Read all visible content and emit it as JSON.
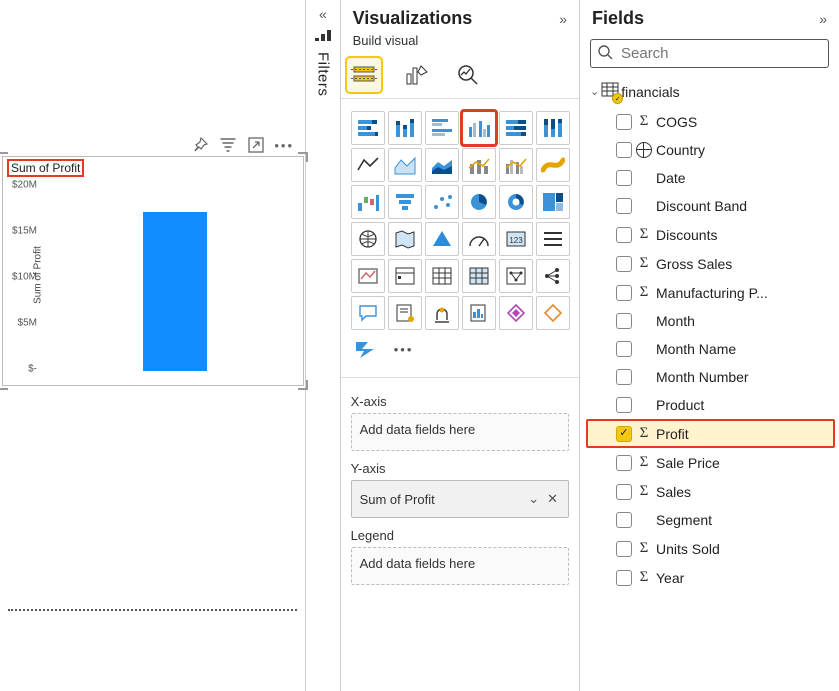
{
  "filters": {
    "label": "Filters"
  },
  "visualizations": {
    "title": "Visualizations",
    "subtitle": "Build visual",
    "wells": {
      "xaxis": {
        "label": "X-axis",
        "placeholder": "Add data fields here"
      },
      "yaxis": {
        "label": "Y-axis",
        "value": "Sum of Profit"
      },
      "legend": {
        "label": "Legend",
        "placeholder": "Add data fields here"
      }
    }
  },
  "fields": {
    "title": "Fields",
    "search_placeholder": "Search",
    "table": "financials",
    "items": [
      {
        "name": "COGS",
        "sigma": true,
        "checked": false
      },
      {
        "name": "Country",
        "globe": true,
        "checked": false
      },
      {
        "name": "Date",
        "checked": false
      },
      {
        "name": "Discount Band",
        "checked": false
      },
      {
        "name": "Discounts",
        "sigma": true,
        "checked": false
      },
      {
        "name": "Gross Sales",
        "sigma": true,
        "checked": false
      },
      {
        "name": "Manufacturing P...",
        "sigma": true,
        "checked": false
      },
      {
        "name": "Month",
        "checked": false
      },
      {
        "name": "Month Name",
        "checked": false
      },
      {
        "name": "Month Number",
        "checked": false
      },
      {
        "name": "Product",
        "checked": false
      },
      {
        "name": "Profit",
        "sigma": true,
        "checked": true,
        "highlight": true
      },
      {
        "name": "Sale Price",
        "sigma": true,
        "checked": false
      },
      {
        "name": "Sales",
        "sigma": true,
        "checked": false
      },
      {
        "name": "Segment",
        "checked": false
      },
      {
        "name": "Units Sold",
        "sigma": true,
        "checked": false
      },
      {
        "name": "Year",
        "sigma": true,
        "checked": false
      }
    ]
  },
  "visual": {
    "title": "Sum of Profit",
    "ylabel": "Sum of Profit",
    "ticks": [
      "$20M",
      "$15M",
      "$10M",
      "$5M",
      "$-"
    ]
  },
  "chart_data": {
    "type": "bar",
    "title": "Sum of Profit",
    "ylabel": "Sum of Profit",
    "ylim": [
      0,
      20000000
    ],
    "yticks": [
      0,
      5000000,
      10000000,
      15000000,
      20000000
    ],
    "ytick_labels": [
      "$-",
      "$5M",
      "$10M",
      "$15M",
      "$20M"
    ],
    "categories": [
      ""
    ],
    "values": [
      17000000
    ]
  }
}
